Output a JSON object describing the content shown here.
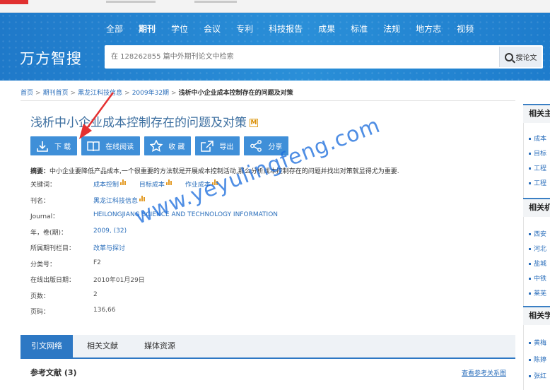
{
  "top_nav": {
    "items": [
      "全部",
      "期刊",
      "学位",
      "会议",
      "专利",
      "科技报告",
      "成果",
      "标准",
      "法规",
      "地方志",
      "视频"
    ],
    "active": "期刊"
  },
  "brand": "万方智搜",
  "search": {
    "placeholder": "在 128262855 篇中外期刊论文中检索",
    "button_label": "搜论文"
  },
  "breadcrumb": {
    "items": [
      "首页",
      "期刊首页",
      "黑龙江科技信息",
      "2009年32期"
    ],
    "current": "浅析中小企业成本控制存在的问题及对策"
  },
  "article": {
    "title": "浅析中小企业成本控制存在的问题及对策",
    "badge": "M",
    "actions": [
      {
        "label": "下  载",
        "icon": "download-icon"
      },
      {
        "label": "在线阅读",
        "icon": "book-icon"
      },
      {
        "label": "收  藏",
        "icon": "star-icon"
      },
      {
        "label": "导出",
        "icon": "export-icon"
      },
      {
        "label": "分享",
        "icon": "share-icon"
      }
    ],
    "abstract_label": "摘要：",
    "abstract": "中小企业要降低产品成本,一个很重要的方法就是开展成本控制活动,那么分析成本控制存在的问题并找出对策就显得尤为重要.",
    "keywords_label": "关键词：",
    "keywords": [
      "成本控制",
      "目标成本",
      "作业成本"
    ],
    "journal_label": "刊名：",
    "journal": "黑龙江科技信息",
    "journal_en_label": "Journal：",
    "journal_en": "HEILONGJIANG SCIENCE AND TECHNOLOGY INFORMATION",
    "year_label": "年，卷(期)：",
    "year": "2009, (32)",
    "column_label": "所属期刊栏目：",
    "column": "改革与探讨",
    "class_label": "分类号：",
    "class": "F2",
    "pubdate_label": "在线出版日期：",
    "pubdate": "2010年01月29日",
    "pages_label": "页数：",
    "pages": "2",
    "pagenum_label": "页码：",
    "pagenum": "136,66"
  },
  "tabs": {
    "items": [
      "引文网络",
      "相关文献",
      "媒体资源"
    ],
    "active": "引文网络"
  },
  "refs": {
    "title": "参考文献 (3)",
    "link": "查看参考关系图"
  },
  "sidebar": {
    "sections": [
      {
        "title": "相关主",
        "items": [
          "成本",
          "目标",
          "工程",
          "工程"
        ]
      },
      {
        "title": "相关机",
        "items": [
          "西安",
          "河北",
          "盐城",
          "中铁",
          "莱芜"
        ]
      },
      {
        "title": "相关学",
        "items": [
          "黄梅",
          "陈婷",
          "张红"
        ]
      }
    ]
  },
  "watermark": "www.yeyulingfeng.com",
  "colors": {
    "header_blue": "#2a8fd8",
    "action_blue": "#3f8fd8",
    "link_blue": "#2a6ebb",
    "title_blue": "#3d6fa0",
    "arrow_red": "#e53030",
    "chart_orange": "#e39a24"
  }
}
